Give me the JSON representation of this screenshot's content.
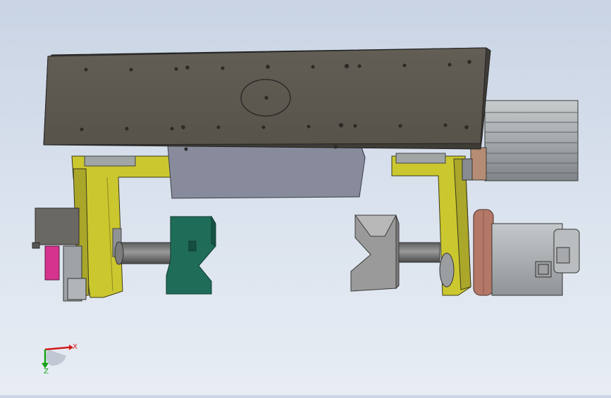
{
  "viewport": {
    "background": "#d6dfeb",
    "triad": {
      "x_label": "X",
      "z_label": "Z",
      "x_color": "#d11a1a",
      "z_color": "#15a315"
    }
  },
  "colors": {
    "plate": "#5a564e",
    "plate_edge": "#3f3c35",
    "bracket": "#c9c630",
    "shield": "#8a8e9e",
    "left_jaw": "#1e6e5a",
    "right_jaw": "#9a9a9a",
    "cylinder": "#9ea5a8",
    "motor": "#a9aeb0",
    "flange": "#b57a6a",
    "pink_part": "#d6338f"
  }
}
